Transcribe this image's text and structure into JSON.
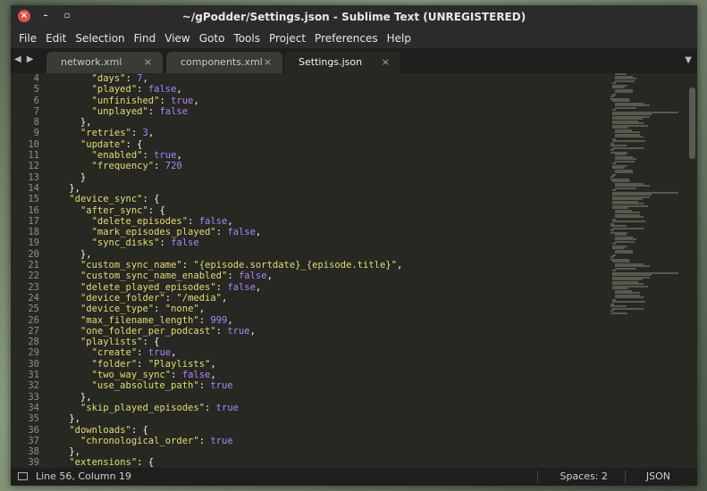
{
  "window": {
    "title": "~/gPodder/Settings.json - Sublime Text (UNREGISTERED)",
    "close_glyph": "×",
    "min_glyph": "–",
    "max_glyph": "▫"
  },
  "menu": [
    "File",
    "Edit",
    "Selection",
    "Find",
    "View",
    "Goto",
    "Tools",
    "Project",
    "Preferences",
    "Help"
  ],
  "tabs": [
    {
      "label": "network.xml",
      "active": false
    },
    {
      "label": "components.xml",
      "active": false
    },
    {
      "label": "Settings.json",
      "active": true
    }
  ],
  "tab_close_glyph": "×",
  "nav": {
    "back": "◀",
    "forward": "▶",
    "tab_menu": "▼"
  },
  "code_lines": [
    {
      "n": "4",
      "t": [
        [
          "        ",
          ""
        ],
        [
          "\"days\"",
          "key"
        ],
        [
          ": ",
          ""
        ],
        [
          "7",
          "number"
        ],
        [
          ",",
          ""
        ]
      ]
    },
    {
      "n": "5",
      "t": [
        [
          "        ",
          ""
        ],
        [
          "\"played\"",
          "key"
        ],
        [
          ": ",
          ""
        ],
        [
          "false",
          "bool"
        ],
        [
          ",",
          ""
        ]
      ]
    },
    {
      "n": "6",
      "t": [
        [
          "        ",
          ""
        ],
        [
          "\"unfinished\"",
          "key"
        ],
        [
          ": ",
          ""
        ],
        [
          "true",
          "bool"
        ],
        [
          ",",
          ""
        ]
      ]
    },
    {
      "n": "7",
      "t": [
        [
          "        ",
          ""
        ],
        [
          "\"unplayed\"",
          "key"
        ],
        [
          ": ",
          ""
        ],
        [
          "false",
          "bool"
        ]
      ]
    },
    {
      "n": "8",
      "t": [
        [
          "      },",
          ""
        ]
      ]
    },
    {
      "n": "9",
      "t": [
        [
          "      ",
          ""
        ],
        [
          "\"retries\"",
          "key"
        ],
        [
          ": ",
          ""
        ],
        [
          "3",
          "number"
        ],
        [
          ",",
          ""
        ]
      ]
    },
    {
      "n": "10",
      "t": [
        [
          "      ",
          ""
        ],
        [
          "\"update\"",
          "key"
        ],
        [
          ": {",
          ""
        ]
      ]
    },
    {
      "n": "11",
      "t": [
        [
          "        ",
          ""
        ],
        [
          "\"enabled\"",
          "key"
        ],
        [
          ": ",
          ""
        ],
        [
          "true",
          "bool"
        ],
        [
          ",",
          ""
        ]
      ]
    },
    {
      "n": "12",
      "t": [
        [
          "        ",
          ""
        ],
        [
          "\"frequency\"",
          "key"
        ],
        [
          ": ",
          ""
        ],
        [
          "720",
          "number"
        ]
      ]
    },
    {
      "n": "13",
      "t": [
        [
          "      }",
          ""
        ]
      ]
    },
    {
      "n": "14",
      "t": [
        [
          "    },",
          ""
        ]
      ]
    },
    {
      "n": "15",
      "t": [
        [
          "    ",
          ""
        ],
        [
          "\"device_sync\"",
          "key"
        ],
        [
          ": {",
          ""
        ]
      ]
    },
    {
      "n": "16",
      "t": [
        [
          "      ",
          ""
        ],
        [
          "\"after_sync\"",
          "key"
        ],
        [
          ": {",
          ""
        ]
      ]
    },
    {
      "n": "17",
      "t": [
        [
          "        ",
          ""
        ],
        [
          "\"delete_episodes\"",
          "key"
        ],
        [
          ": ",
          ""
        ],
        [
          "false",
          "bool"
        ],
        [
          ",",
          ""
        ]
      ]
    },
    {
      "n": "18",
      "t": [
        [
          "        ",
          ""
        ],
        [
          "\"mark_episodes_played\"",
          "key"
        ],
        [
          ": ",
          ""
        ],
        [
          "false",
          "bool"
        ],
        [
          ",",
          ""
        ]
      ]
    },
    {
      "n": "19",
      "t": [
        [
          "        ",
          ""
        ],
        [
          "\"sync_disks\"",
          "key"
        ],
        [
          ": ",
          ""
        ],
        [
          "false",
          "bool"
        ]
      ]
    },
    {
      "n": "20",
      "t": [
        [
          "      },",
          ""
        ]
      ]
    },
    {
      "n": "21",
      "t": [
        [
          "      ",
          ""
        ],
        [
          "\"custom_sync_name\"",
          "key"
        ],
        [
          ": ",
          ""
        ],
        [
          "\"{episode.sortdate}_{episode.title}\"",
          "string"
        ],
        [
          ",",
          ""
        ]
      ]
    },
    {
      "n": "22",
      "t": [
        [
          "      ",
          ""
        ],
        [
          "\"custom_sync_name_enabled\"",
          "key"
        ],
        [
          ": ",
          ""
        ],
        [
          "false",
          "bool"
        ],
        [
          ",",
          ""
        ]
      ]
    },
    {
      "n": "23",
      "t": [
        [
          "      ",
          ""
        ],
        [
          "\"delete_played_episodes\"",
          "key"
        ],
        [
          ": ",
          ""
        ],
        [
          "false",
          "bool"
        ],
        [
          ",",
          ""
        ]
      ]
    },
    {
      "n": "24",
      "t": [
        [
          "      ",
          ""
        ],
        [
          "\"device_folder\"",
          "key"
        ],
        [
          ": ",
          ""
        ],
        [
          "\"/media\"",
          "string"
        ],
        [
          ",",
          ""
        ]
      ]
    },
    {
      "n": "25",
      "t": [
        [
          "      ",
          ""
        ],
        [
          "\"device_type\"",
          "key"
        ],
        [
          ": ",
          ""
        ],
        [
          "\"none\"",
          "string"
        ],
        [
          ",",
          ""
        ]
      ]
    },
    {
      "n": "26",
      "t": [
        [
          "      ",
          ""
        ],
        [
          "\"max_filename_length\"",
          "key"
        ],
        [
          ": ",
          ""
        ],
        [
          "999",
          "number"
        ],
        [
          ",",
          ""
        ]
      ]
    },
    {
      "n": "27",
      "t": [
        [
          "      ",
          ""
        ],
        [
          "\"one_folder_per_podcast\"",
          "key"
        ],
        [
          ": ",
          ""
        ],
        [
          "true",
          "bool"
        ],
        [
          ",",
          ""
        ]
      ]
    },
    {
      "n": "28",
      "t": [
        [
          "      ",
          ""
        ],
        [
          "\"playlists\"",
          "key"
        ],
        [
          ": {",
          ""
        ]
      ]
    },
    {
      "n": "29",
      "t": [
        [
          "        ",
          ""
        ],
        [
          "\"create\"",
          "key"
        ],
        [
          ": ",
          ""
        ],
        [
          "true",
          "bool"
        ],
        [
          ",",
          ""
        ]
      ]
    },
    {
      "n": "30",
      "t": [
        [
          "        ",
          ""
        ],
        [
          "\"folder\"",
          "key"
        ],
        [
          ": ",
          ""
        ],
        [
          "\"Playlists\"",
          "string"
        ],
        [
          ",",
          ""
        ]
      ]
    },
    {
      "n": "31",
      "t": [
        [
          "        ",
          ""
        ],
        [
          "\"two_way_sync\"",
          "key"
        ],
        [
          ": ",
          ""
        ],
        [
          "false",
          "bool"
        ],
        [
          ",",
          ""
        ]
      ]
    },
    {
      "n": "32",
      "t": [
        [
          "        ",
          ""
        ],
        [
          "\"use_absolute_path\"",
          "key"
        ],
        [
          ": ",
          ""
        ],
        [
          "true",
          "bool"
        ]
      ]
    },
    {
      "n": "33",
      "t": [
        [
          "      },",
          ""
        ]
      ]
    },
    {
      "n": "34",
      "t": [
        [
          "      ",
          ""
        ],
        [
          "\"skip_played_episodes\"",
          "key"
        ],
        [
          ": ",
          ""
        ],
        [
          "true",
          "bool"
        ]
      ]
    },
    {
      "n": "35",
      "t": [
        [
          "    },",
          ""
        ]
      ]
    },
    {
      "n": "36",
      "t": [
        [
          "    ",
          ""
        ],
        [
          "\"downloads\"",
          "key"
        ],
        [
          ": {",
          ""
        ]
      ]
    },
    {
      "n": "37",
      "t": [
        [
          "      ",
          ""
        ],
        [
          "\"chronological_order\"",
          "key"
        ],
        [
          ": ",
          ""
        ],
        [
          "true",
          "bool"
        ]
      ]
    },
    {
      "n": "38",
      "t": [
        [
          "    },",
          ""
        ]
      ]
    },
    {
      "n": "39",
      "t": [
        [
          "    ",
          ""
        ],
        [
          "\"extensions\"",
          "key"
        ],
        [
          ": {",
          ""
        ]
      ]
    }
  ],
  "colors": {
    "background": "#272822",
    "string": "#e6db74",
    "number": "#ae81ff",
    "text": "#f8f8f2",
    "line_number": "#8f908a"
  },
  "status": {
    "position": "Line 56, Column 19",
    "spaces": "Spaces: 2",
    "syntax": "JSON"
  }
}
